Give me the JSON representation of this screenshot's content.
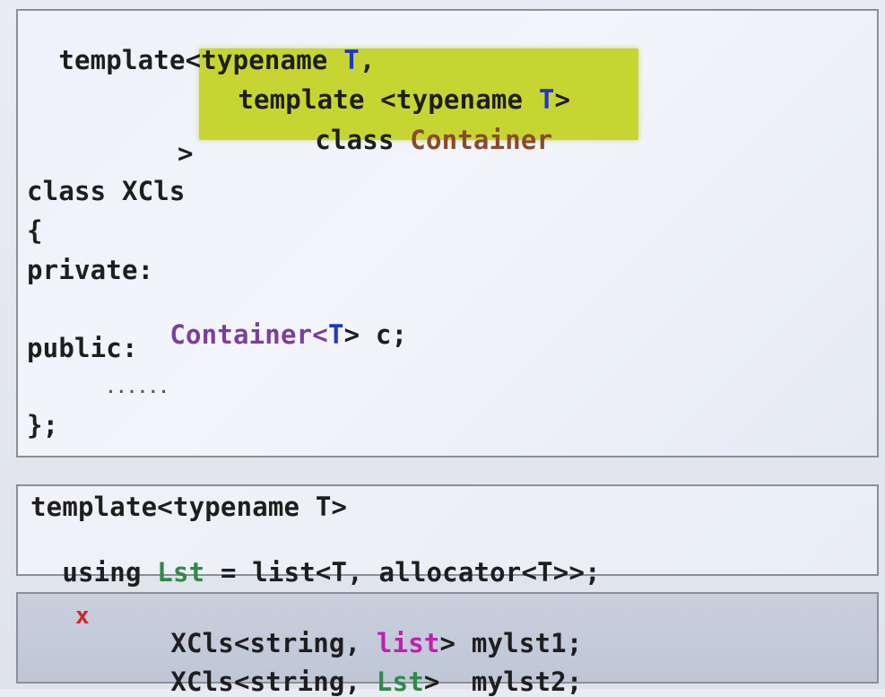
{
  "box1": {
    "l1": {
      "a": "template<typename ",
      "b": "T",
      "c": ","
    },
    "l2": {
      "a": "template <typename ",
      "b": "T",
      "c": ">"
    },
    "l3": {
      "a": "class ",
      "b": "Container"
    },
    "l4": ">",
    "l5": "class XCls",
    "l6": "{",
    "l7": "private:",
    "l8": {
      "a": "Container",
      "b": "<",
      "c": "T",
      "d": "> c;"
    },
    "l9": "public:",
    "dots": "......",
    "l10": "};"
  },
  "box2": {
    "l1": "template<typename T>",
    "l2": {
      "a": "using ",
      "b": "Lst",
      "c": " = list<T, allocator<T>>;"
    }
  },
  "box3": {
    "mark": "x",
    "l1": {
      "a": "XCls<string, ",
      "b": "list",
      "c": "> mylst1;"
    },
    "l2": {
      "a": "XCls<string, ",
      "b": "Lst",
      "c": ">  mylst2;"
    }
  },
  "colors": {
    "keyword_blue": "#1c39c8",
    "container_purple": "#7b3f9e",
    "container_brown": "#8a4a2c",
    "alias_green": "#2f8a4a",
    "list_magenta": "#c020b0",
    "mark_red": "#d0262a",
    "highlight": "#c7d532"
  }
}
